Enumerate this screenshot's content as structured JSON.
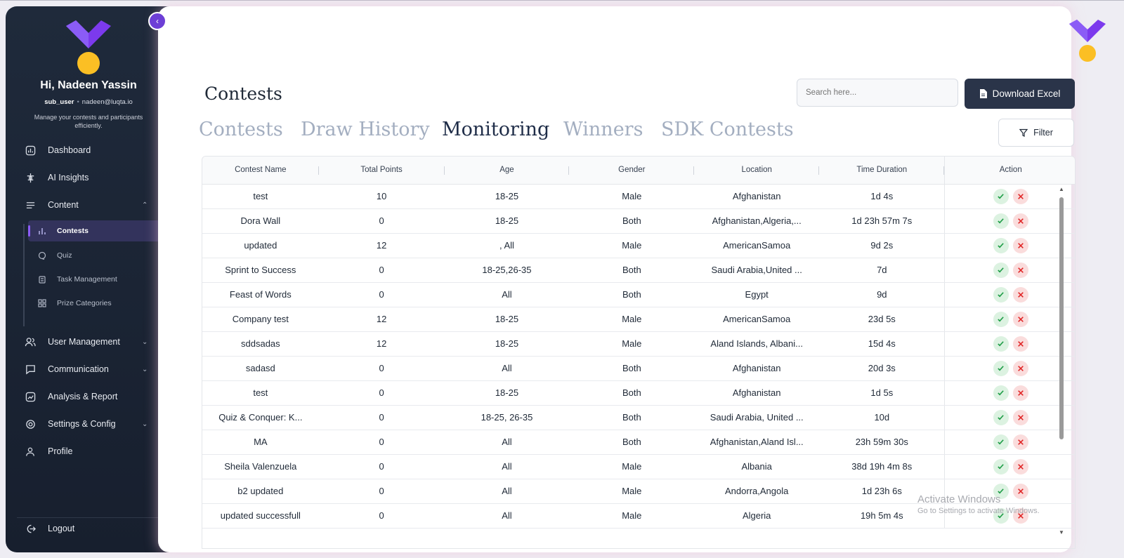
{
  "sidebar": {
    "greeting": "Hi, Nadeen Yassin",
    "role": "sub_user",
    "email": "nadeen@luqta.io",
    "tagline": "Manage your contests and participants efficiently.",
    "items": [
      {
        "label": "Dashboard",
        "icon": "dashboard-icon"
      },
      {
        "label": "AI Insights",
        "icon": "ai-icon"
      },
      {
        "label": "Content",
        "icon": "content-icon"
      },
      {
        "label": "User Management",
        "icon": "users-icon"
      },
      {
        "label": "Communication",
        "icon": "chat-icon"
      },
      {
        "label": "Analysis & Report",
        "icon": "report-icon"
      },
      {
        "label": "Settings & Config",
        "icon": "gear-icon"
      },
      {
        "label": "Profile",
        "icon": "user-icon"
      }
    ],
    "content_sub": [
      {
        "label": "Contests",
        "icon": "bar-chart-icon"
      },
      {
        "label": "Quiz",
        "icon": "quiz-icon"
      },
      {
        "label": "Task Management",
        "icon": "clipboard-icon"
      },
      {
        "label": "Prize Categories",
        "icon": "grid-icon"
      }
    ],
    "logout": "Logout"
  },
  "header": {
    "title": "Contests",
    "search_placeholder": "Search here...",
    "download_label": "Download Excel",
    "filter_label": "Filter"
  },
  "tabs": [
    {
      "label": "Contests",
      "active": false
    },
    {
      "label": "Draw History",
      "active": false
    },
    {
      "label": "Monitoring",
      "active": true
    },
    {
      "label": "Winners",
      "active": false
    },
    {
      "label": "SDK Contests",
      "active": false
    }
  ],
  "table": {
    "columns": [
      "Contest Name",
      "Total Points",
      "Age",
      "Gender",
      "Location",
      "Time Duration",
      "Action"
    ],
    "rows": [
      [
        "test",
        "10",
        "18-25",
        "Male",
        "Afghanistan",
        "1d 4s"
      ],
      [
        "Dora Wall",
        "0",
        "18-25",
        "Both",
        "Afghanistan,Algeria,...",
        "1d 23h 57m 7s"
      ],
      [
        "updated",
        "12",
        ", All",
        "Male",
        "AmericanSamoa",
        "9d 2s"
      ],
      [
        "Sprint to Success",
        "0",
        "18-25,26-35",
        "Both",
        "Saudi Arabia,United ...",
        "7d"
      ],
      [
        "Feast of Words",
        "0",
        "All",
        "Both",
        "Egypt",
        "9d"
      ],
      [
        "Company test",
        "12",
        "18-25",
        "Male",
        "AmericanSamoa",
        "23d 5s"
      ],
      [
        "sddsadas",
        "12",
        "18-25",
        "Male",
        "Aland Islands, Albani...",
        "15d 4s"
      ],
      [
        "sadasd",
        "0",
        "All",
        "Both",
        "Afghanistan",
        "20d 3s"
      ],
      [
        "test",
        "0",
        "18-25",
        "Both",
        "Afghanistan",
        "1d 5s"
      ],
      [
        "Quiz & Conquer: K...",
        "0",
        "18-25, 26-35",
        "Both",
        "Saudi Arabia, United ...",
        "10d"
      ],
      [
        "MA",
        "0",
        "All",
        "Both",
        "Afghanistan,Aland Isl...",
        "23h 59m 30s"
      ],
      [
        "Sheila Valenzuela",
        "0",
        "All",
        "Male",
        "Albania",
        "38d 19h 4m 8s"
      ],
      [
        "b2 updated",
        "0",
        "All",
        "Male",
        "Andorra,Angola",
        "1d 23h 6s"
      ],
      [
        "updated successfull",
        "0",
        "All",
        "Male",
        "Algeria",
        "19h 5m 4s"
      ]
    ]
  },
  "watermark": {
    "line1": "Activate Windows",
    "line2": "Go to Settings to activate Windows."
  },
  "colors": {
    "accent": "#6d3fd6",
    "sidebar": "#1c2536",
    "approve": "#1f9d47",
    "reject": "#e02424"
  }
}
